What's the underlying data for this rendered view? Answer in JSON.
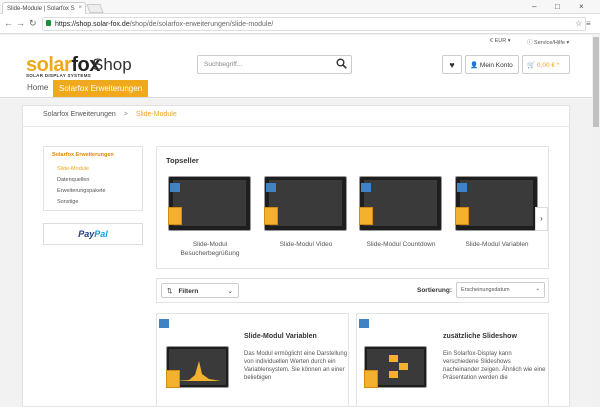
{
  "browser": {
    "tab_title": "Slide-Module | Solarfox S",
    "url_host": "https://shop.solar-fox.de",
    "url_path": "/shop/de/solarfox-erweiterungen/slide-module/"
  },
  "topbar": {
    "currency": "€ EUR ▾",
    "service": "Service/Hilfe ▾"
  },
  "header": {
    "logo_solar": "solar",
    "logo_fox": "fox",
    "logo_sub": "SOLAR DISPLAY SYSTEMS",
    "shop_label": "Shop",
    "search_placeholder": "Suchbegriff...",
    "account_label": "Mein Konto",
    "cart_total": "0,00 € *"
  },
  "menu": {
    "home": "Home",
    "active": "Solarfox Erweiterungen"
  },
  "breadcrumb": {
    "parent": "Solarfox Erweiterungen",
    "separator": ">",
    "current": "Slide-Module"
  },
  "sidebar": {
    "title": "Solarfox Erweiterungen",
    "items": [
      "Slide-Module",
      "Datenquellen",
      "Erweiterungspakete",
      "Sonstige"
    ]
  },
  "paypal": {
    "pay": "Pay",
    "pal": "Pal"
  },
  "topseller": {
    "title": "Topseller",
    "products": [
      {
        "line1": "Slide-Modul",
        "line2": "Besucherbegrüßung"
      },
      {
        "line1": "Slide-Modul Video",
        "line2": ""
      },
      {
        "line1": "Slide-Modul Countdown",
        "line2": ""
      },
      {
        "line1": "Slide-Modul Variablen",
        "line2": ""
      }
    ],
    "next": "›"
  },
  "filter": {
    "label": "Filtern",
    "sort_label": "Sortierung:",
    "sort_value": "Erscheinungsdatum"
  },
  "cards": [
    {
      "title": "Slide-Modul Variablen",
      "desc": "Das Modul ermöglicht eine Darstellung von individuellen Werten durch ein Variablensystem. Sie können an einer beliebigen"
    },
    {
      "title": "zusätzliche Slideshow",
      "desc": "Ein Solarfox-Display kann verschiedene Slideshows nacheinander zeigen. Ähnlich wie eine Präsentation werden die"
    }
  ],
  "colors": {
    "accent": "#f0a81c",
    "badge": "#3f83c4"
  }
}
